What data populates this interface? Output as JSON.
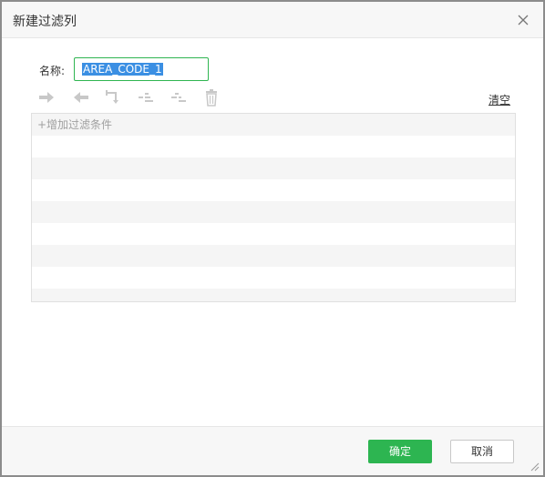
{
  "dialog": {
    "title": "新建过滤列",
    "close_icon": "close-icon"
  },
  "form": {
    "name_label": "名称:",
    "name_value": "AREA_CODE_1"
  },
  "toolbar": {
    "icons": [
      "arrow-right-icon",
      "arrow-left-icon",
      "swap-branch-icon",
      "indent-icon",
      "outdent-icon",
      "trash-icon"
    ],
    "clear_label": "清空"
  },
  "conditions": {
    "add_label": "+增加过滤条件",
    "rows": []
  },
  "footer": {
    "ok_label": "确定",
    "cancel_label": "取消"
  },
  "colors": {
    "accent": "#2db551",
    "selection": "#3b8fe3",
    "disabled_icon": "#c8c8c8"
  }
}
